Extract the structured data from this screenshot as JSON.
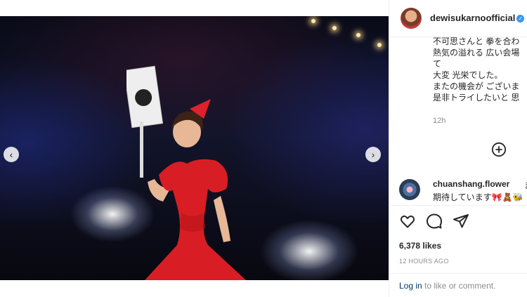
{
  "post": {
    "username": "dewisukarnoofficial",
    "caption_lines": [
      "不可思さんと 拳を合わ",
      "熱気の溢れる 広い会場",
      "て",
      "大変 光栄でした。",
      "またの機会が ございま",
      "是非トライしたいと 思"
    ],
    "time_ago_short": "12h",
    "likes": "6,378 likes",
    "timestamp": "12 HOURS AGO"
  },
  "comment": {
    "username": "chuanshang.flower",
    "text_continuation": "ま",
    "text": "期待しています🎀🧸🐝"
  },
  "footer": {
    "login_link": "Log in",
    "login_suffix": " to like or comment."
  },
  "carousel": {
    "slide_count": 4,
    "active_index": 2
  },
  "icons": [
    "verified-badge-icon",
    "add-comment-icon",
    "heart-icon",
    "comment-icon",
    "share-icon",
    "chevron-left-icon",
    "chevron-right-icon"
  ],
  "colors": {
    "link": "#00376b",
    "verified": "#3897f0",
    "dress": "#d81e24"
  }
}
